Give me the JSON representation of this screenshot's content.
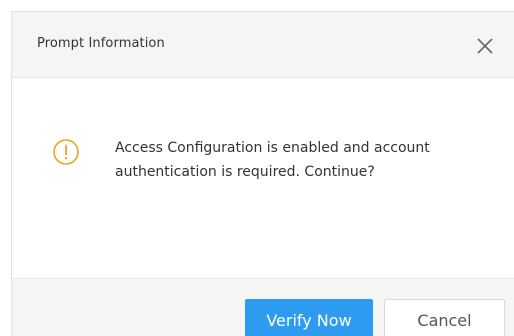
{
  "dialog": {
    "title": "Prompt Information",
    "close_icon": "close-icon",
    "message": "Access Configuration is enabled and account authentication is required. Continue?",
    "warning_icon": "warning-circle-icon",
    "buttons": {
      "primary_label": "Verify Now",
      "secondary_label": "Cancel"
    }
  },
  "colors": {
    "primary": "#2d9cf0",
    "warning": "#f0a020",
    "header_bg": "#f5f5f5"
  }
}
